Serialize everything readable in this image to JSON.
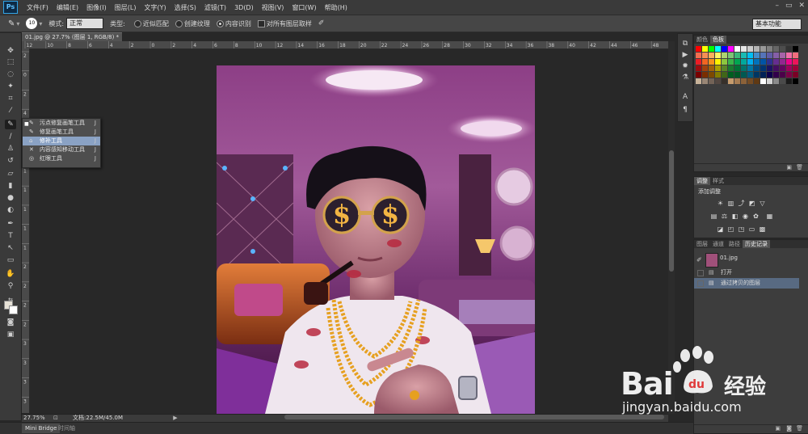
{
  "app": {
    "logo": "Ps",
    "window_controls": [
      "–",
      "▭",
      "✕"
    ]
  },
  "menu": [
    "文件(F)",
    "编辑(E)",
    "图像(I)",
    "图层(L)",
    "文字(Y)",
    "选择(S)",
    "滤镜(T)",
    "3D(D)",
    "视图(V)",
    "窗口(W)",
    "帮助(H)"
  ],
  "options": {
    "brush_size": "10",
    "mode_label": "模式:",
    "mode_value": "正常",
    "type_label": "类型:",
    "radio1": "近似匹配",
    "radio2": "创建纹理",
    "radio3": "内容识别",
    "sample_all": "对所有图层取样",
    "workspace": "基本功能"
  },
  "document": {
    "tab_title": "01.jpg @ 27.7% (图层 1, RGB/8) *",
    "close": "×",
    "zoom": "27.75%",
    "doc_info": "文档:22.5M/45.0M"
  },
  "ruler_top_ticks": [
    "12",
    "10",
    "8",
    "6",
    "4",
    "2",
    "0",
    "2",
    "4",
    "6",
    "8",
    "10",
    "12",
    "14",
    "16",
    "18",
    "20",
    "22",
    "24",
    "26",
    "28",
    "30",
    "32",
    "34",
    "36",
    "38",
    "40",
    "42",
    "44",
    "46",
    "48"
  ],
  "ruler_left_ticks": [
    "2",
    "0",
    "2",
    "4",
    "6",
    "8",
    "1",
    "1",
    "1",
    "1",
    "1",
    "2",
    "2",
    "2",
    "2",
    "3",
    "3",
    "3",
    "3"
  ],
  "flyout": {
    "items": [
      {
        "icon": "✎",
        "label": "污点修复画笔工具",
        "key": "J"
      },
      {
        "icon": "✎",
        "label": "修复画笔工具",
        "key": "J"
      },
      {
        "icon": "⌂",
        "label": "修补工具",
        "key": "J"
      },
      {
        "icon": "✕",
        "label": "内容感知移动工具",
        "key": "J"
      },
      {
        "icon": "◎",
        "label": "红眼工具",
        "key": "J"
      }
    ]
  },
  "bottom_tabs": [
    "Mini Bridge",
    "时间轴"
  ],
  "panels": {
    "color_tabs": [
      "颜色",
      "色板"
    ],
    "adjust_tabs": [
      "调整",
      "样式"
    ],
    "adjust_title": "添加调整",
    "layers_tabs": [
      "图层",
      "通道",
      "路径",
      "历史记录"
    ],
    "history": [
      {
        "label": "01.jpg",
        "type": "snapshot"
      },
      {
        "label": "打开",
        "type": "step"
      },
      {
        "label": "通过拷贝的图层",
        "type": "step"
      }
    ]
  },
  "watermark": {
    "text": "Bai",
    "brand2": "经验",
    "url": "jingyan.baidu.com"
  },
  "swatch_colors": [
    "#ff0000",
    "#ffff00",
    "#00ff00",
    "#00ffff",
    "#0000ff",
    "#ff00ff",
    "#ffffff",
    "#e6e6e6",
    "#cccccc",
    "#b3b3b3",
    "#999999",
    "#808080",
    "#666666",
    "#4d4d4d",
    "#333333",
    "#000000",
    "#f26c4f",
    "#f68e55",
    "#fbaf5c",
    "#fff467",
    "#acd372",
    "#7cc576",
    "#3bb878",
    "#1abbb4",
    "#00bff3",
    "#438ccb",
    "#5574b9",
    "#605ca8",
    "#855fa8",
    "#a763a8",
    "#f06ea9",
    "#f26d7d",
    "#ed1c24",
    "#f26522",
    "#f7941d",
    "#fff200",
    "#8dc73f",
    "#39b54a",
    "#00a651",
    "#00a99d",
    "#00aeef",
    "#0072bc",
    "#0054a6",
    "#2e3192",
    "#662d91",
    "#92278f",
    "#ec008c",
    "#ed145b",
    "#9e0b0f",
    "#a0410d",
    "#a36209",
    "#aba000",
    "#598527",
    "#1a7b30",
    "#007236",
    "#00746b",
    "#0076a3",
    "#004b80",
    "#003471",
    "#1b1464",
    "#440e62",
    "#630460",
    "#9e005d",
    "#9e0039",
    "#790000",
    "#7b2e00",
    "#7d4900",
    "#827b00",
    "#406618",
    "#005e20",
    "#005826",
    "#005952",
    "#005b7f",
    "#003663",
    "#002157",
    "#0d004c",
    "#32004b",
    "#4b0049",
    "#7b0046",
    "#7a0026",
    "#c7b299",
    "#998675",
    "#736357",
    "#534741",
    "#37302a",
    "#c69c6d",
    "#a67c52",
    "#8c6239",
    "#754c24",
    "#603913",
    "#ffffff",
    "#d4d4d4",
    "#8a8a8a",
    "#4a4a4a",
    "#1a1a1a",
    "#000000"
  ]
}
